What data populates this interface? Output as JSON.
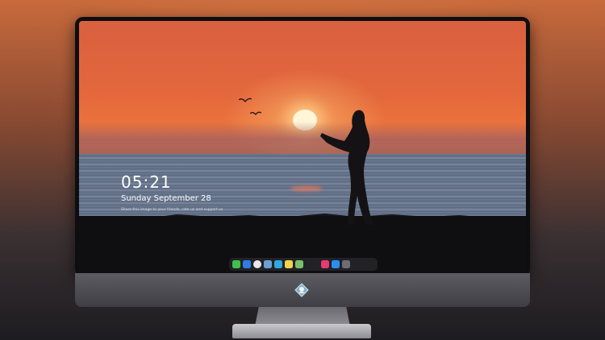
{
  "lockscreen": {
    "time": "05:21",
    "date": "Sunday September  28",
    "note": "Share this image to your friends, rate us and support us"
  },
  "dock": {
    "icons": [
      {
        "name": "messages-icon",
        "color": "#3fc14a"
      },
      {
        "name": "finder-icon",
        "color": "#2f7be8"
      },
      {
        "name": "safari-icon",
        "color": "#e8e8ea"
      },
      {
        "name": "preview-icon",
        "color": "#6aa0d8"
      },
      {
        "name": "clapper-icon",
        "color": "#2ea8e0"
      },
      {
        "name": "notes-icon",
        "color": "#f3d34a"
      },
      {
        "name": "photos-icon",
        "color": "#7ac06a"
      },
      {
        "name": "music-icon",
        "color": "#e83a70"
      },
      {
        "name": "app-store-icon",
        "color": "#2a8ef0"
      },
      {
        "name": "camera-icon",
        "color": "#6d6d75"
      }
    ]
  }
}
